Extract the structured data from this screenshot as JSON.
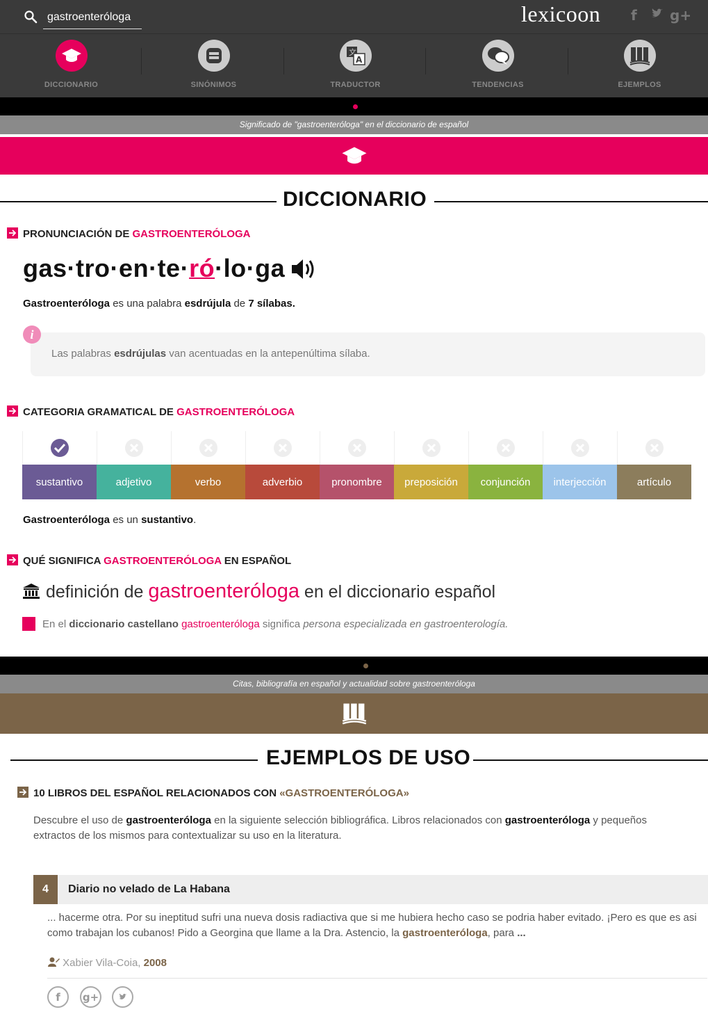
{
  "search": {
    "value": "gastroenteróloga"
  },
  "logo": "lexicoon",
  "social_top": {
    "facebook": "f",
    "twitter": "t",
    "google": "g+"
  },
  "nav": [
    {
      "label": "DICCIONARIO",
      "icon": "graduation-cap-icon",
      "active": true
    },
    {
      "label": "SINÓNIMOS",
      "icon": "equals-icon",
      "active": false
    },
    {
      "label": "TRADUCTOR",
      "icon": "translate-icon",
      "active": false
    },
    {
      "label": "TENDENCIAS",
      "icon": "chat-bubbles-icon",
      "active": false
    },
    {
      "label": "EJEMPLOS",
      "icon": "books-icon",
      "active": false
    }
  ],
  "dict_banner": "Significado de \"gastroenteróloga\" en el diccionario de español",
  "dict_title": "DICCIONARIO",
  "pron": {
    "heading_prefix": "PRONUNCIACIÓN DE ",
    "heading_word": "GASTROENTERÓLOGA",
    "syllables": [
      "gas",
      "tro",
      "en",
      "te",
      "ró",
      "lo",
      "ga"
    ],
    "stressed_index": 4,
    "sentence": {
      "word": "Gastroenteróloga",
      "t1": " es una palabra ",
      "type": "esdrújula",
      "t2": " de ",
      "count": "7 sílabas."
    },
    "info": {
      "t1": "Las palabras ",
      "type": "esdrújulas",
      "t2": " van acentuadas en la antepenúltima sílaba."
    }
  },
  "category": {
    "heading_prefix": "CATEGORIA GRAMATICAL DE ",
    "heading_word": "GASTROENTERÓLOGA",
    "items": [
      {
        "label": "sustantivo",
        "color": "#6b5b95",
        "checked": true
      },
      {
        "label": "adjetivo",
        "color": "#45b29d",
        "checked": false
      },
      {
        "label": "verbo",
        "color": "#b5722f",
        "checked": false
      },
      {
        "label": "adverbio",
        "color": "#b84a3b",
        "checked": false
      },
      {
        "label": "pronombre",
        "color": "#b5526b",
        "checked": false
      },
      {
        "label": "preposición",
        "color": "#c9a93a",
        "checked": false
      },
      {
        "label": "conjunción",
        "color": "#8ab33f",
        "checked": false
      },
      {
        "label": "interjección",
        "color": "#9cc4ea",
        "checked": false
      },
      {
        "label": "artículo",
        "color": "#8c7d5c",
        "checked": false
      }
    ],
    "sentence": {
      "word": "Gastroenteróloga",
      "t1": " es un ",
      "type": "sustantivo",
      "t2": "."
    }
  },
  "meaning": {
    "heading_prefix": "QUÉ SIGNIFICA ",
    "heading_word": "GASTROENTERÓLOGA",
    "heading_suffix": " EN ESPAÑOL",
    "def_t1": "definición de ",
    "def_word": "gastroenteróloga",
    "def_t2": " en el diccionario español",
    "line": {
      "t1": "En el ",
      "dict": "diccionario castellano",
      "word": " gastroenteróloga",
      "t2": " significa ",
      "meaning": "persona especializada en gastroenterología."
    }
  },
  "examples_banner": "Citas, bibliografía en español y actualidad sobre gastroenteróloga",
  "examples_title": "EJEMPLOS DE USO",
  "books": {
    "heading_prefix": "10 LIBROS DEL ESPAÑOL RELACIONADOS CON ",
    "heading_word": "«GASTROENTERÓLOGA»",
    "intro": {
      "t1": "Descubre el uso de ",
      "w1": "gastroenteróloga",
      "t2": " en la siguiente selección bibliográfica. Libros relacionados con ",
      "w2": "gastroenteróloga",
      "t3": " y pequeños",
      "line2": "extractos de los mismos para contextualizar su uso en la literatura."
    },
    "item": {
      "number": "4",
      "title": "Diario no velado de La Habana",
      "excerpt_t1": "... hacerme otra. Por su ineptitud sufri una nueva dosis radiactiva que si me hubiera hecho caso se podria haber evitado. ¡Pero es que es asi como trabajan los cubanos! Pido a Georgina que llame a la Dra. Astencio, la ",
      "excerpt_word": "gastroenteróloga",
      "excerpt_t2": ", para ",
      "excerpt_end": "...",
      "author": "Xabier Vila-Coia, ",
      "year": "2008",
      "share": {
        "facebook": "f",
        "google": "g+",
        "twitter": "t"
      }
    }
  },
  "colors": {
    "pink": "#e6005c",
    "brown": "#7b6448",
    "dark": "#3a3a3a"
  }
}
